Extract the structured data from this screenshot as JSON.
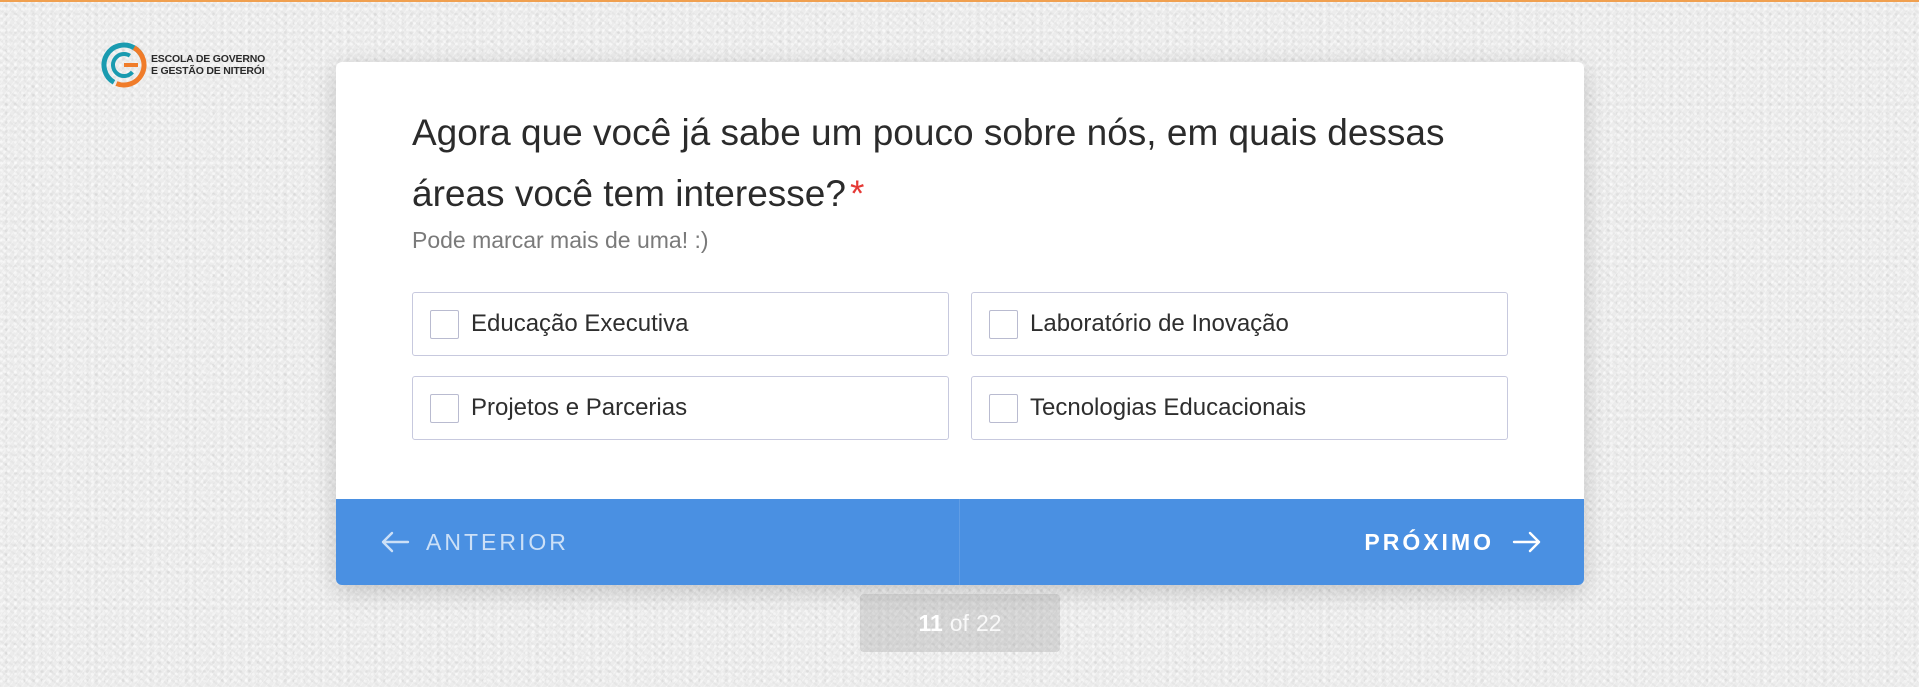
{
  "logo": {
    "line1": "ESCOLA DE GOVERNO",
    "line2": "E GESTÃO DE NITERÓI"
  },
  "question": {
    "text": "Agora que você já sabe um pouco sobre nós, em quais dessas áreas você tem interesse?",
    "required_mark": "*",
    "subtitle": "Pode marcar mais de uma! :)"
  },
  "options": [
    {
      "label": "Educação Executiva",
      "checked": false
    },
    {
      "label": "Laboratório de Inovação",
      "checked": false
    },
    {
      "label": "Projetos e Parcerias",
      "checked": false
    },
    {
      "label": "Tecnologias Educacionais",
      "checked": false
    }
  ],
  "navigation": {
    "prev_label": "ANTERIOR",
    "next_label": "PRÓXIMO"
  },
  "pager": {
    "current": "11",
    "separator": "of",
    "total": "22"
  },
  "colors": {
    "accent": "#4a90e2",
    "required": "#e53935",
    "top_line": "#f0a050",
    "logo_orange": "#f07c2a",
    "logo_teal": "#1a9bb0"
  }
}
